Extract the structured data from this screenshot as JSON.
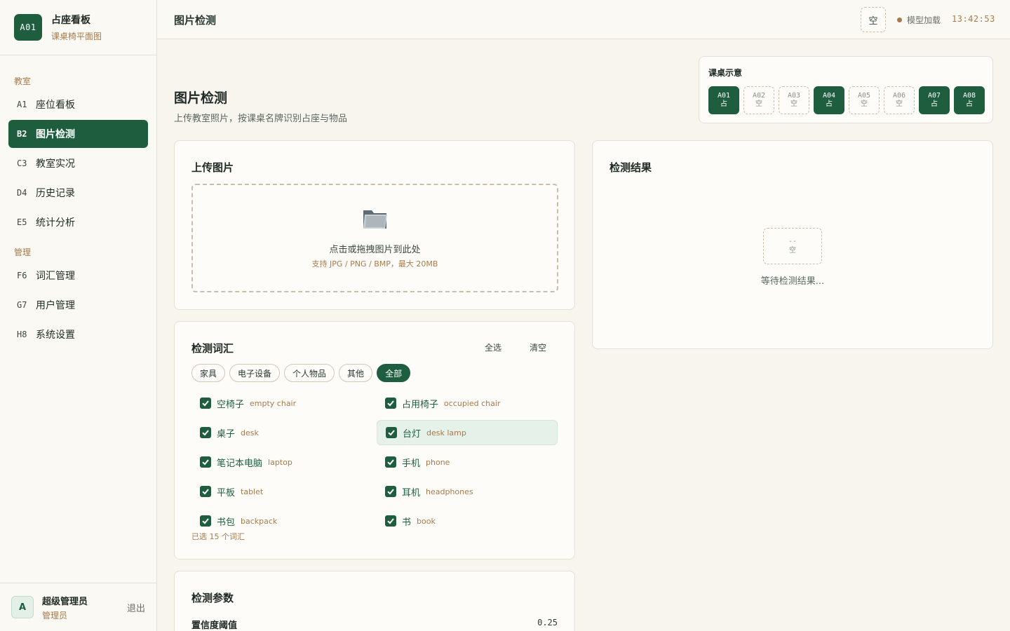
{
  "brand": {
    "badge": "A01",
    "title": "占座看板",
    "subtitle": "课桌椅平面图"
  },
  "nav": {
    "section1": "教室",
    "section2": "管理",
    "items": [
      {
        "code": "A1",
        "label": "座位看板"
      },
      {
        "code": "B2",
        "label": "图片检测"
      },
      {
        "code": "C3",
        "label": "教室实况"
      },
      {
        "code": "D4",
        "label": "历史记录"
      },
      {
        "code": "E5",
        "label": "统计分析"
      },
      {
        "code": "F6",
        "label": "词汇管理"
      },
      {
        "code": "G7",
        "label": "用户管理"
      },
      {
        "code": "H8",
        "label": "系统设置"
      }
    ]
  },
  "user": {
    "avatar": "A",
    "name": "超级管理员",
    "role": "管理员",
    "logout": "退出"
  },
  "topbar": {
    "title": "图片检测",
    "toggle": "空",
    "model_status": "模型加载",
    "clock": "13:42:53"
  },
  "page": {
    "title": "图片检测",
    "subtitle": "上传教室照片，按课桌名牌识别占座与物品"
  },
  "legend": {
    "title": "课桌示意",
    "desks": [
      {
        "id": "A01",
        "state": "占",
        "occupied": true
      },
      {
        "id": "A02",
        "state": "空",
        "occupied": false
      },
      {
        "id": "A03",
        "state": "空",
        "occupied": false
      },
      {
        "id": "A04",
        "state": "占",
        "occupied": true
      },
      {
        "id": "A05",
        "state": "空",
        "occupied": false
      },
      {
        "id": "A06",
        "state": "空",
        "occupied": false
      },
      {
        "id": "A07",
        "state": "占",
        "occupied": true
      },
      {
        "id": "A08",
        "state": "占",
        "occupied": true
      }
    ]
  },
  "upload": {
    "title": "上传图片",
    "icon": "folder-icon",
    "main_text": "点击或拖拽图片到此处",
    "hint": "支持 JPG / PNG / BMP，最大 20MB"
  },
  "vocab": {
    "title": "检测词汇",
    "select_all": "全选",
    "clear": "清空",
    "chips": [
      {
        "label": "家具",
        "active": false
      },
      {
        "label": "电子设备",
        "active": false
      },
      {
        "label": "个人物品",
        "active": false
      },
      {
        "label": "其他",
        "active": false
      },
      {
        "label": "全部",
        "active": true
      }
    ],
    "items": [
      {
        "zh": "空椅子",
        "en": "empty chair",
        "checked": true
      },
      {
        "zh": "占用椅子",
        "en": "occupied chair",
        "checked": true
      },
      {
        "zh": "桌子",
        "en": "desk",
        "checked": true
      },
      {
        "zh": "台灯",
        "en": "desk lamp",
        "checked": true
      },
      {
        "zh": "笔记本电脑",
        "en": "laptop",
        "checked": true
      },
      {
        "zh": "手机",
        "en": "phone",
        "checked": true
      },
      {
        "zh": "平板",
        "en": "tablet",
        "checked": true
      },
      {
        "zh": "耳机",
        "en": "headphones",
        "checked": true
      },
      {
        "zh": "书包",
        "en": "backpack",
        "checked": true
      },
      {
        "zh": "书",
        "en": "book",
        "checked": true
      }
    ],
    "count": "已选 15 个词汇"
  },
  "result": {
    "title": "检测结果",
    "placeholder_top": "--",
    "placeholder_bottom": "空",
    "empty_text": "等待检测结果..."
  },
  "params": {
    "title": "检测参数",
    "confidence_label": "置信度阈值",
    "confidence_value": "0.25"
  },
  "colors": {
    "accent": "#1e5e3f",
    "warm": "#a9794a",
    "background": "#f8f5ee"
  }
}
